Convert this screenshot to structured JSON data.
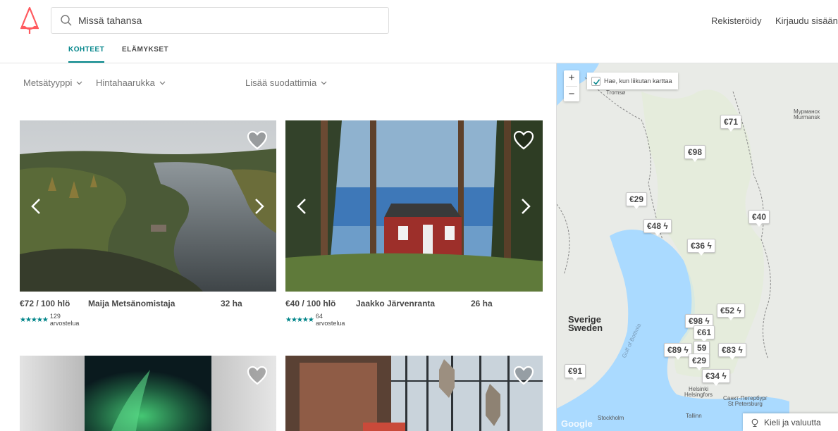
{
  "header": {
    "search_placeholder": "Missä tahansa",
    "register": "Rekisteröidy",
    "login": "Kirjaudu sisään"
  },
  "tabs": [
    "KOHTEET",
    "ELÄMYKSET"
  ],
  "filters": {
    "forest_type": "Metsätyyppi",
    "price_range": "Hintahaarukka",
    "more": "Lisää suodattimia"
  },
  "listings": [
    {
      "price": "€72 / 100 hlö",
      "owner": "Maija Metsänomistaja",
      "size": "32 ha",
      "stars": "★★★★★",
      "reviews": "129 arvostelua"
    },
    {
      "price": "€40 / 100 hlö",
      "owner": "Jaakko Järvenranta",
      "size": "26 ha",
      "stars": "★★★★★",
      "reviews": "64 arvostelua"
    },
    {
      "price": "",
      "owner": "",
      "size": "",
      "stars": "",
      "reviews": ""
    },
    {
      "price": "",
      "owner": "",
      "size": "",
      "stars": "",
      "reviews": ""
    }
  ],
  "map": {
    "checkbox_label": "Hae, kun liikutan karttaa",
    "zoom_in": "+",
    "zoom_out": "−",
    "pins": [
      "€71",
      "€98",
      "€29",
      "€40",
      "€48 ϟ",
      "€36 ϟ",
      "€52 ϟ",
      "€98 ϟ",
      "€61",
      "€89 ϟ",
      "59",
      "€83 ϟ",
      "€29",
      "€34 ϟ",
      "€91"
    ],
    "labels": {
      "tromso": "Tromsø",
      "murmansk": "Мурманск\nMurmansk",
      "sweden": "Sverige\nSweden",
      "gulf": "Gulf of Bothnia",
      "helsinki": "Helsinki\nHelsingfors",
      "stpete": "Санкт-Петербург\nSt Petersburg",
      "stockholm": "Stockholm",
      "tallinn": "Tallinn"
    },
    "google": "Google",
    "language_button": "Kieli ja valuutta"
  },
  "colors": {
    "accent": "#008489",
    "brand": "#FF5A5F"
  }
}
